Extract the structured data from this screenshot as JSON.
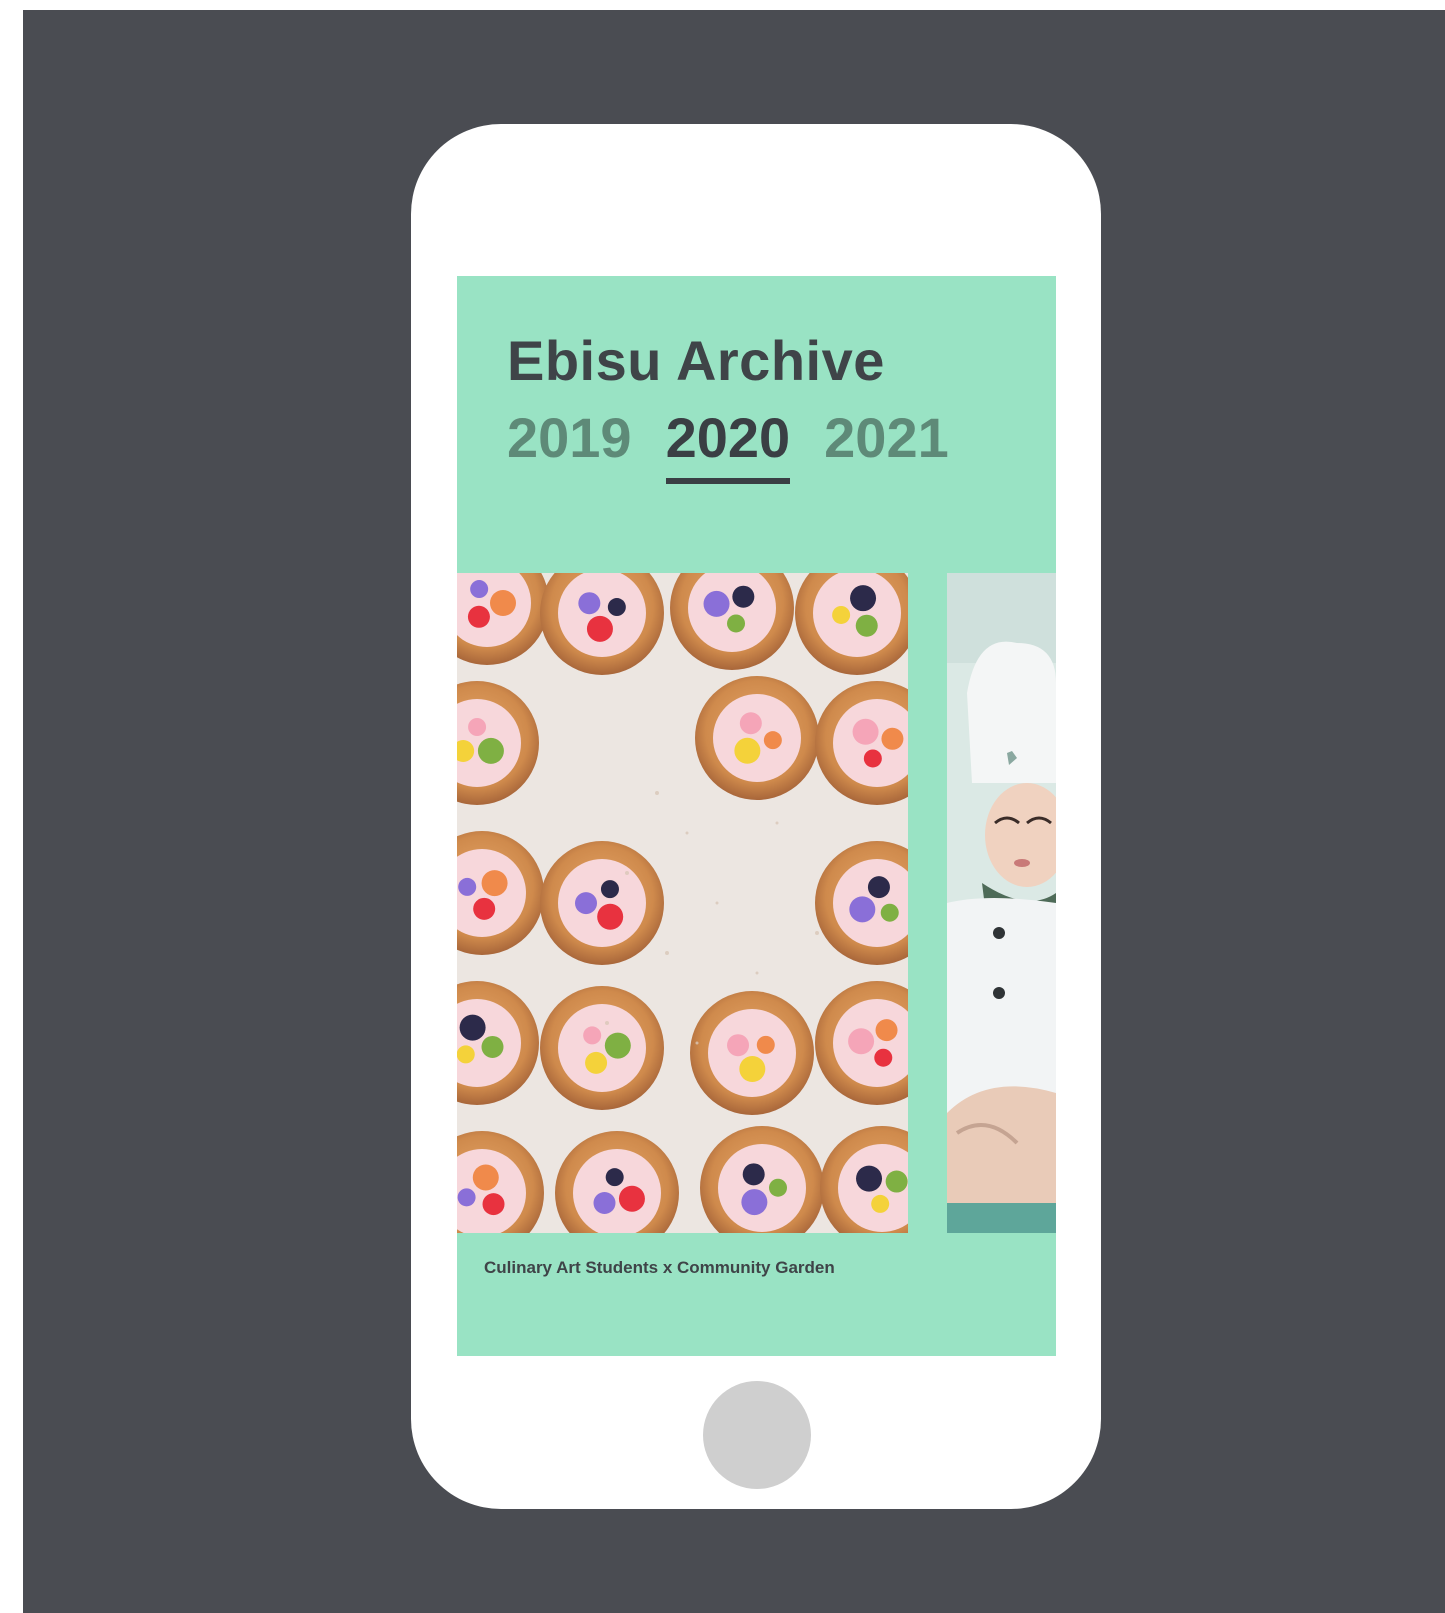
{
  "app": {
    "title": "Ebisu Archive",
    "years": [
      "2019",
      "2020",
      "2021"
    ],
    "selected_year": "2020"
  },
  "gallery": {
    "caption": "Culinary Art Students x Community Garden",
    "main_image": "tarts-with-fruit-and-flowers",
    "side_image": "chef-student-in-white-uniform"
  },
  "colors": {
    "backdrop": "#4a4c52",
    "screen_bg": "#99e3c4",
    "text_dark": "#3f4448",
    "year_inactive": "#5e8a78",
    "home_button": "#cfcfcf"
  }
}
